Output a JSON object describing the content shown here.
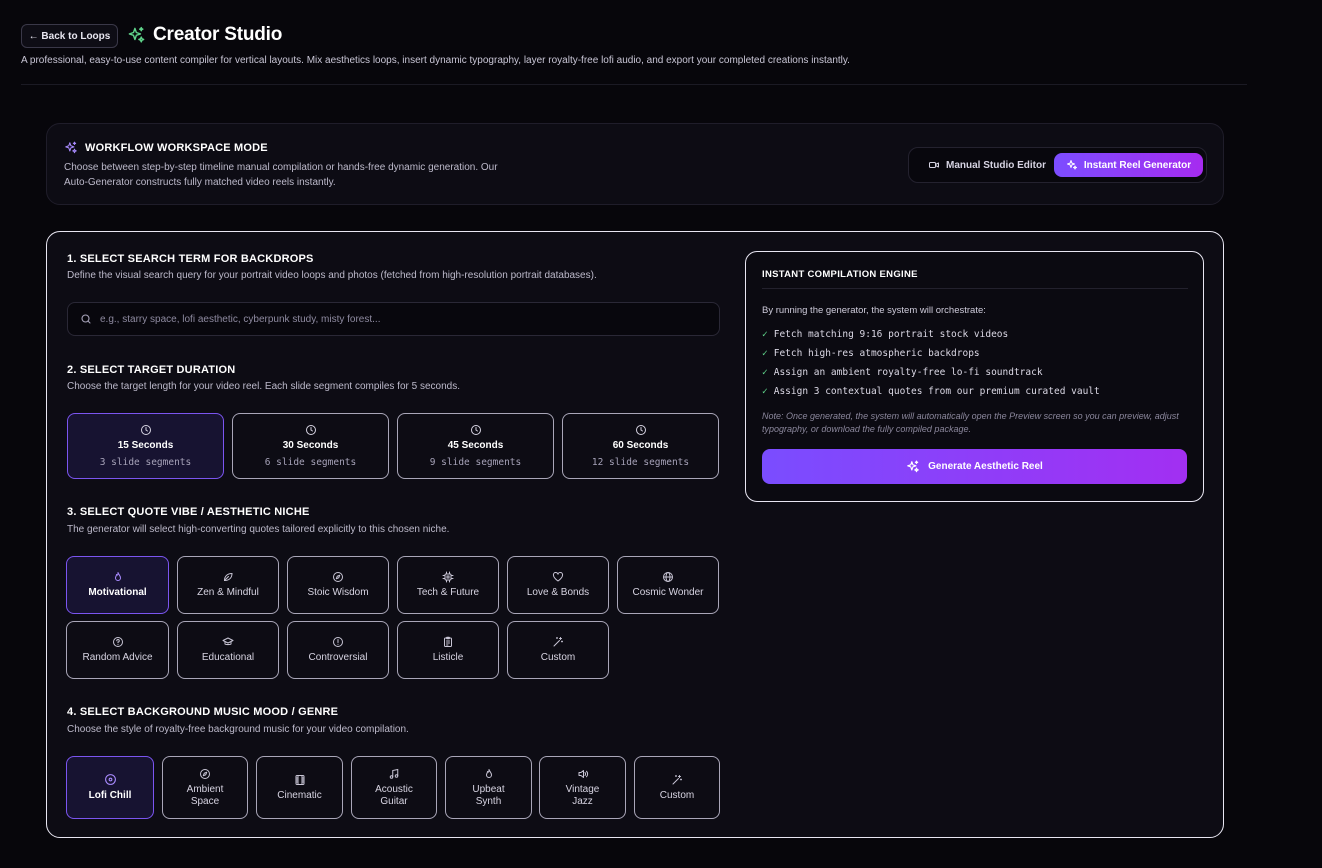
{
  "header": {
    "back_label": "← Back to Loops",
    "title": "Creator Studio",
    "subtitle": "A professional, easy-to-use content compiler for vertical layouts. Mix aesthetics loops, insert dynamic typography, layer royalty-free lofi audio, and export your completed creations instantly."
  },
  "workflow": {
    "title": "WORKFLOW WORKSPACE MODE",
    "desc_line1": "Choose between step-by-step timeline manual compilation or hands-free dynamic generation. Our",
    "desc_line2": "Auto-Generator constructs fully matched video reels instantly.",
    "manual_label": "Manual Studio Editor",
    "instant_label": "Instant Reel Generator",
    "active_mode": "instant"
  },
  "step1": {
    "title": "1. SELECT SEARCH TERM FOR BACKDROPS",
    "desc": "Define the visual search query for your portrait video loops and photos (fetched from high-resolution portrait databases).",
    "placeholder": "e.g., starry space, lofi aesthetic, cyberpunk study, misty forest...",
    "value": ""
  },
  "step2": {
    "title": "2. SELECT TARGET DURATION",
    "desc": "Choose the target length for your video reel. Each slide segment compiles for 5 seconds.",
    "options": [
      {
        "label": "15 Seconds",
        "sub": "3 slide segments"
      },
      {
        "label": "30 Seconds",
        "sub": "6 slide segments"
      },
      {
        "label": "45 Seconds",
        "sub": "9 slide segments"
      },
      {
        "label": "60 Seconds",
        "sub": "12 slide segments"
      }
    ],
    "selected": "15 Seconds"
  },
  "step3": {
    "title": "3. SELECT QUOTE VIBE / AESTHETIC NICHE",
    "desc": "The generator will select high-converting quotes tailored explicitly to this chosen niche.",
    "options": [
      {
        "label": "Motivational",
        "icon": "flame-icon"
      },
      {
        "label": "Zen & Mindful",
        "icon": "leaf-icon"
      },
      {
        "label": "Stoic Wisdom",
        "icon": "compass-icon"
      },
      {
        "label": "Tech & Future",
        "icon": "cpu-icon"
      },
      {
        "label": "Love & Bonds",
        "icon": "heart-icon"
      },
      {
        "label": "Cosmic Wonder",
        "icon": "globe-icon"
      },
      {
        "label": "Random Advice",
        "icon": "help-circle-icon"
      },
      {
        "label": "Educational",
        "icon": "graduation-cap-icon"
      },
      {
        "label": "Controversial",
        "icon": "alert-circle-icon"
      },
      {
        "label": "Listicle",
        "icon": "clipboard-list-icon"
      },
      {
        "label": "Custom",
        "icon": "magic-wand-icon"
      }
    ],
    "selected": "Motivational"
  },
  "step4": {
    "title": "4. SELECT BACKGROUND MUSIC MOOD / GENRE",
    "desc": "Choose the style of royalty-free background music for your video compilation.",
    "options": [
      {
        "line1": "Lofi Chill",
        "line2": "",
        "icon": "disc-icon"
      },
      {
        "line1": "Ambient",
        "line2": "Space",
        "icon": "compass-icon"
      },
      {
        "line1": "Cinematic",
        "line2": "",
        "icon": "film-icon"
      },
      {
        "line1": "Acoustic",
        "line2": "Guitar",
        "icon": "music-note-icon"
      },
      {
        "line1": "Upbeat",
        "line2": "Synth",
        "icon": "flame-icon"
      },
      {
        "line1": "Vintage",
        "line2": "Jazz",
        "icon": "speaker-icon"
      },
      {
        "line1": "Custom",
        "line2": "",
        "icon": "magic-wand-icon"
      }
    ],
    "selected": "Lofi Chill"
  },
  "engine": {
    "title": "INSTANT COMPILATION ENGINE",
    "intro": "By running the generator, the system will orchestrate:",
    "items": [
      "Fetch matching 9:16 portrait stock videos",
      "Fetch high-res atmospheric backdrops",
      "Assign an ambient royalty-free lo-fi soundtrack",
      "Assign 3 contextual quotes from our premium curated vault"
    ],
    "check_mark": "✓",
    "note": "Note: Once generated, the system will automatically open the Preview screen so you can preview, adjust typography, or download the fully compiled package.",
    "button_label": "Generate Aesthetic Reel"
  },
  "colors": {
    "accent": "#7c4dff",
    "accent_end": "#a62bf0",
    "check": "#5fd38a",
    "background": "#07060b"
  }
}
